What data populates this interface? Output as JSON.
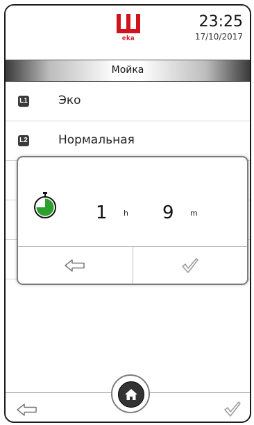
{
  "header": {
    "logo_text": "eka",
    "time": "23:25",
    "date": "17/10/2017"
  },
  "title_bar": {
    "title": "Мойка"
  },
  "program_list": {
    "items": [
      {
        "badge": "L1",
        "label": "Эко"
      },
      {
        "badge": "L2",
        "label": "Нормальная"
      }
    ]
  },
  "duration_dialog": {
    "hours": "1",
    "hours_unit": "h",
    "minutes": "9",
    "minutes_unit": "m",
    "timer_progress_fraction": 0.75,
    "buttons": {
      "back_icon": "arrow-left-icon",
      "confirm_icon": "checkmark-icon"
    }
  },
  "footer": {
    "back_icon": "arrow-left-icon",
    "home_icon": "home-icon",
    "confirm_icon": "checkmark-icon"
  },
  "colors": {
    "brand_red": "#d0141c",
    "timer_green": "#2ca02c",
    "header_dark": "#3a3a3a"
  }
}
